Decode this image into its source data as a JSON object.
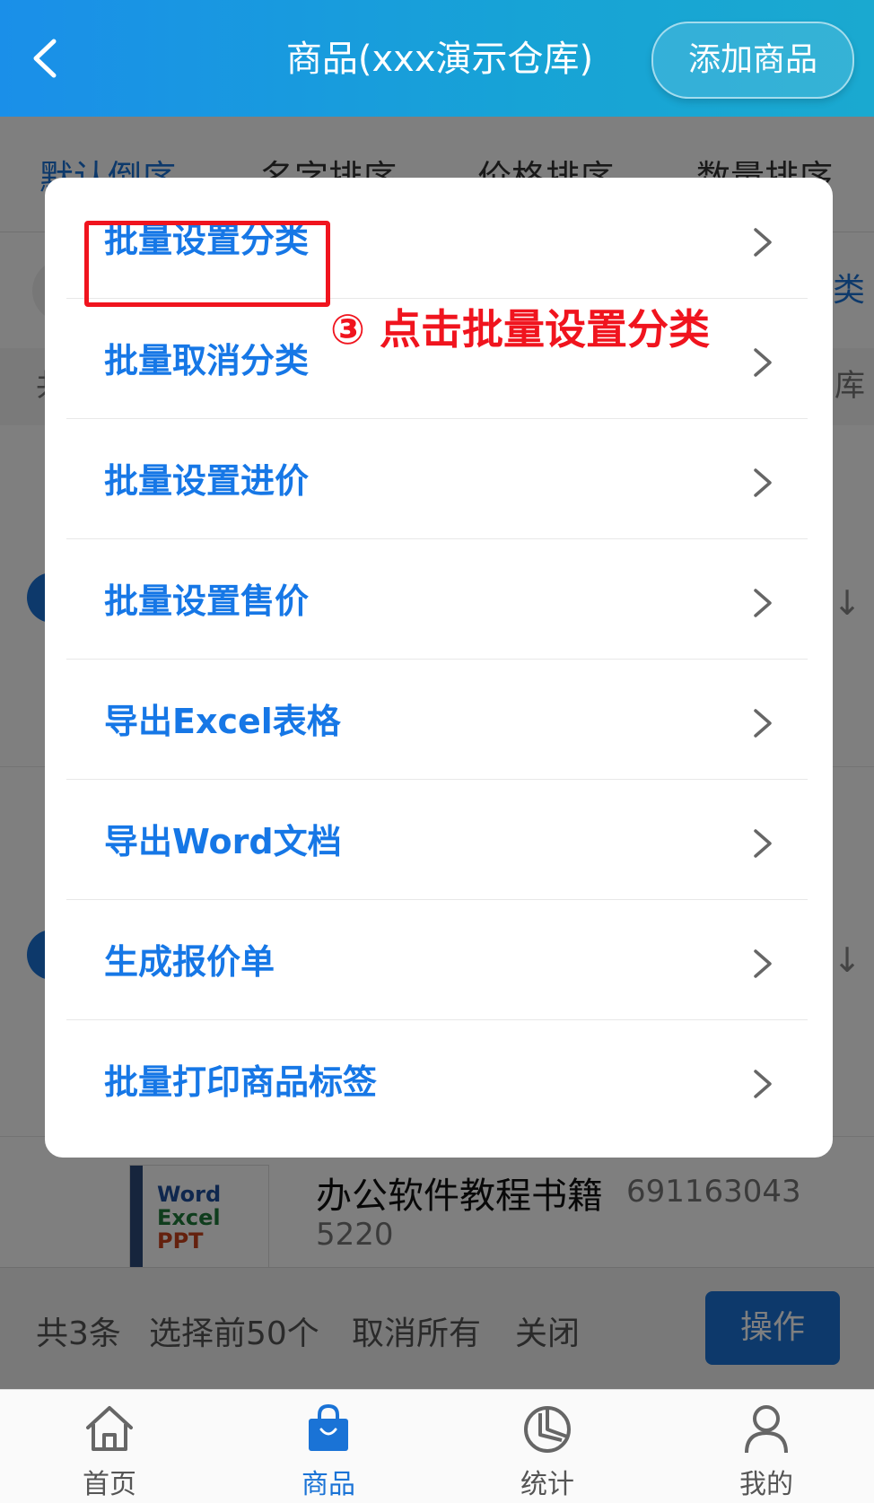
{
  "header": {
    "title": "商品(xxx演示仓库)",
    "add_button": "添加商品"
  },
  "sort_tabs": [
    "默认倒序",
    "名字排序",
    "价格排序",
    "数量排序"
  ],
  "filter": {
    "link": "类"
  },
  "count_row": {
    "left": "共",
    "right": "库"
  },
  "modal": {
    "items": [
      "批量设置分类",
      "批量取消分类",
      "批量设置进价",
      "批量设置售价",
      "导出Excel表格",
      "导出Word文档",
      "生成报价单",
      "批量打印商品标签"
    ]
  },
  "annotation": {
    "text": "③ 点击批量设置分类"
  },
  "product": {
    "name": "办公软件教程书籍",
    "code_part1": "691163043",
    "code_part2": "5220",
    "cover_line1": "Word",
    "cover_line2": "Excel",
    "cover_line3": "PPT"
  },
  "bottom_actions": {
    "total": "共3条",
    "select_first": "选择前50个",
    "cancel_all": "取消所有",
    "close": "关闭",
    "operate": "操作"
  },
  "tab_bar": {
    "items": [
      {
        "label": "首页",
        "icon": "home-icon"
      },
      {
        "label": "商品",
        "icon": "shopping-bag-icon"
      },
      {
        "label": "统计",
        "icon": "pie-chart-icon"
      },
      {
        "label": "我的",
        "icon": "user-icon"
      }
    ],
    "active_index": 1
  },
  "colors": {
    "primary": "#1a73d6",
    "menu_text": "#1677e6",
    "annotation_red": "#f0141e"
  }
}
